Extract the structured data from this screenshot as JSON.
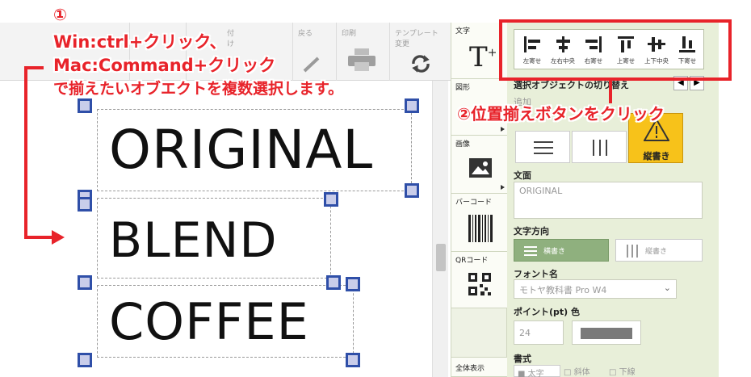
{
  "toolbar": {
    "b1": "",
    "b2": "",
    "b3": "付け",
    "undo": "戻る",
    "print": "印刷",
    "template_l1": "テンプレート",
    "template_l2": "変更"
  },
  "canvas": {
    "obj1": "ORIGINAL",
    "obj2": "BLEND",
    "obj3": "COFFEE"
  },
  "tools": {
    "text": "文字",
    "shape": "図形",
    "image": "画像",
    "barcode": "バーコード",
    "qrcode": "QRコード",
    "fullview": "全体表示"
  },
  "align": {
    "left": "左寄せ",
    "hcenter": "左右中央",
    "right": "右寄せ",
    "top": "上寄せ",
    "vcenter": "上下中央",
    "bottom": "下寄せ"
  },
  "props": {
    "select_obj": "選択オブジェクトの切り替え",
    "add": "追加",
    "vertical_btn": "縦書き",
    "body_label": "文面",
    "body_value": "ORIGINAL",
    "direction_label": "文字方向",
    "dir_horizontal": "横書き",
    "dir_vertical": "縦書き",
    "font_label": "フォント名",
    "font_value": "モトヤ教科書 Pro W4",
    "point_label": "ポイント(pt) 色",
    "point_value": "24",
    "style_label": "書式",
    "bold": "太字",
    "italic": "斜体",
    "underline": "下線",
    "accent_color": "#6a9a5a"
  },
  "annotation": {
    "step1": "①",
    "line1": "Win:ctrl+クリック、",
    "line2": "Mac:Command+クリック",
    "line3": "で揃えたいオブエクトを複数選択します。",
    "step2": "②位置揃えボタンをクリック",
    "color": "#e8232a"
  }
}
